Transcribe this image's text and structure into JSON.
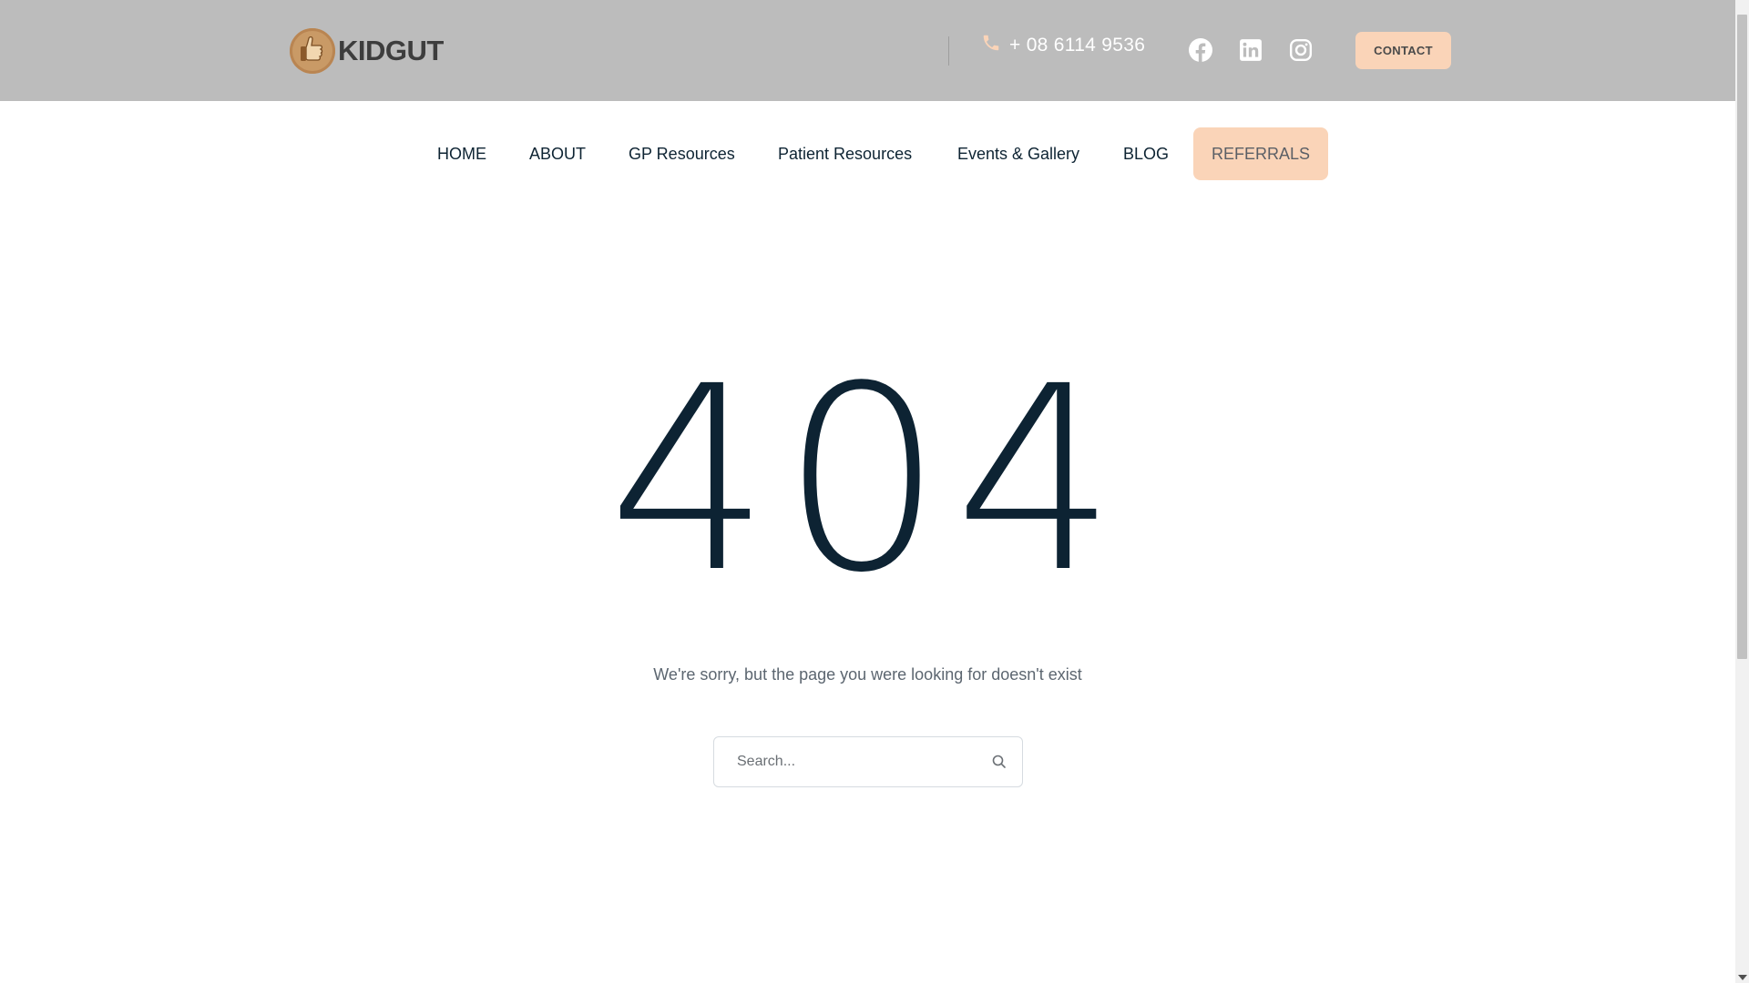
{
  "header": {
    "logo_text": "KIDGUT",
    "logo_icon": "thumbs-up-icon",
    "phone": "+ 08 6114 9536",
    "phone_icon": "phone-icon",
    "social": [
      "facebook-icon",
      "linkedin-icon",
      "instagram-icon"
    ],
    "contact_label": "CONTACT"
  },
  "nav": {
    "items": [
      {
        "label": "HOME"
      },
      {
        "label": "ABOUT"
      },
      {
        "label": "GP Resources"
      },
      {
        "label": "Patient Resources"
      },
      {
        "label": "Events & Gallery"
      },
      {
        "label": "BLOG"
      },
      {
        "label": "REFERRALS"
      }
    ]
  },
  "main": {
    "error_code": "404",
    "message": "We're sorry, but the page you were looking for doesn't exist",
    "search": {
      "placeholder": "Search...",
      "value": ""
    }
  },
  "colors": {
    "topbar_bg": "#bcbcbc",
    "accent_peach": "#fad4b8",
    "brand_brown": "#c99a66",
    "text_dark": "#0d2333"
  }
}
